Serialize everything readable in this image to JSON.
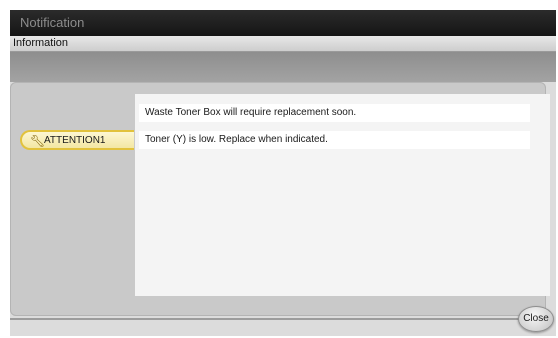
{
  "window": {
    "title": "Notification",
    "subtitle": "Information"
  },
  "attention_tab": {
    "label": "ATTENTION1",
    "icon": "wrench-icon"
  },
  "messages": [
    "Waste Toner Box will require replacement soon.",
    "Toner (Y) is low. Replace when indicated."
  ],
  "buttons": {
    "close_label": "Close"
  },
  "colors": {
    "title_bar": "#1e1e1e",
    "attention_fill": "#fbf3c4",
    "attention_border": "#e2c23c",
    "message_area": "#f4f4f4",
    "panel": "#c9c9c9"
  }
}
